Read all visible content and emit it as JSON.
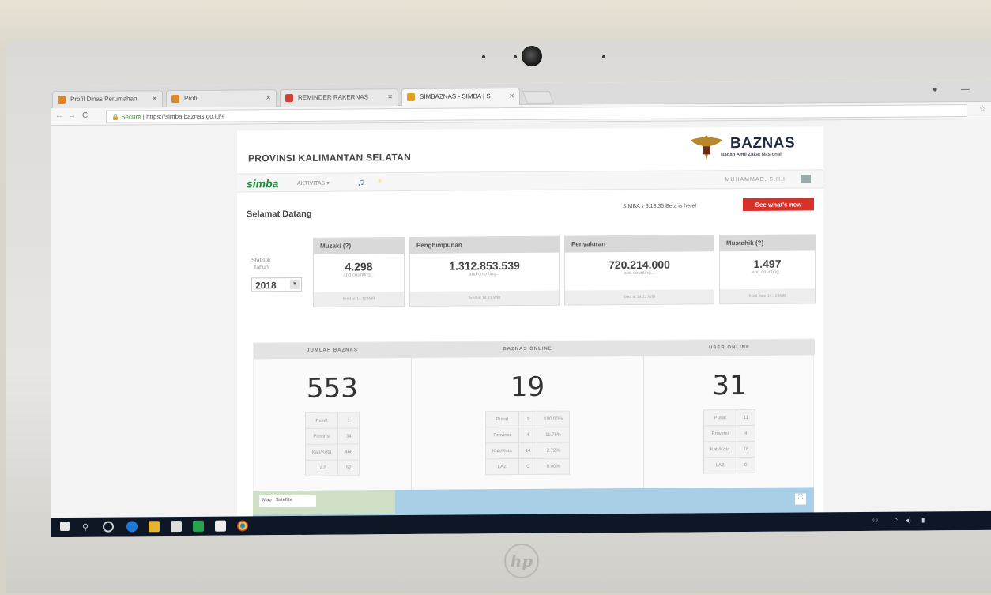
{
  "browser": {
    "tabs": [
      {
        "label": "Profil Dinas Perumahan",
        "fav_color": "#d88a2a"
      },
      {
        "label": "Profil",
        "fav_color": "#d88a2a"
      },
      {
        "label": "REMINDER RAKERNAS",
        "fav_color": "#d24136"
      },
      {
        "label": "SIMBAZNAS - SIMBA | S",
        "fav_color": "#e0a21e"
      }
    ],
    "url_secure": "Secure",
    "url": "https://simba.baznas.go.id/#"
  },
  "header": {
    "province": "PROVINSI KALIMANTAN SELATAN",
    "brand": "BAZNAS",
    "brand_sub": "Badan Amil Zakat Nasional"
  },
  "menubar": {
    "logo": "simba",
    "aktivitas": "AKTIVITAS",
    "user": "MUHAMMAD, S.H.I"
  },
  "welcome": "Selamat Datang",
  "beta_notice": "SIMBA v 5.18.35 Beta is here!",
  "whats_new": "See what's new",
  "stat": {
    "label_line1": "Statistik",
    "label_line2": "Tahun",
    "year": "2018"
  },
  "cards": [
    {
      "title": "Muzaki (?)",
      "value": "4.298",
      "sub": "and counting...",
      "foot": "fixed at 14.12.WIB"
    },
    {
      "title": "Penghimpunan",
      "value": "1.312.853.539",
      "sub": "and counting...",
      "foot": "fixed at 14.12.WIB"
    },
    {
      "title": "Penyaluran",
      "value": "720.214.000",
      "sub": "and counting...",
      "foot": "fixed at 14.12.WIB"
    },
    {
      "title": "Mustahik (?)",
      "value": "1.497",
      "sub": "and counting...",
      "foot": "fixed date 14.12.WIB"
    }
  ],
  "summary": [
    {
      "title": "JUMLAH BAZNAS",
      "value": "553",
      "rows": [
        [
          "Pusat",
          "1"
        ],
        [
          "Provinsi",
          "34"
        ],
        [
          "Kab/Kota",
          "466"
        ],
        [
          "LAZ",
          "52"
        ]
      ]
    },
    {
      "title": "BAZNAS ONLINE",
      "value": "19",
      "rows": [
        [
          "Pusat",
          "1",
          "100.00%"
        ],
        [
          "Provinsi",
          "4",
          "11.76%"
        ],
        [
          "Kab/Kota",
          "14",
          "2.72%"
        ],
        [
          "LAZ",
          "0",
          "0.00%"
        ]
      ]
    },
    {
      "title": "USER ONLINE",
      "value": "31",
      "rows": [
        [
          "Pusat",
          "11"
        ],
        [
          "Provinsi",
          "4"
        ],
        [
          "Kab/Kota",
          "16"
        ],
        [
          "LAZ",
          "0"
        ]
      ]
    }
  ],
  "map": {
    "map_label": "Map",
    "satellite_label": "Satellite"
  }
}
